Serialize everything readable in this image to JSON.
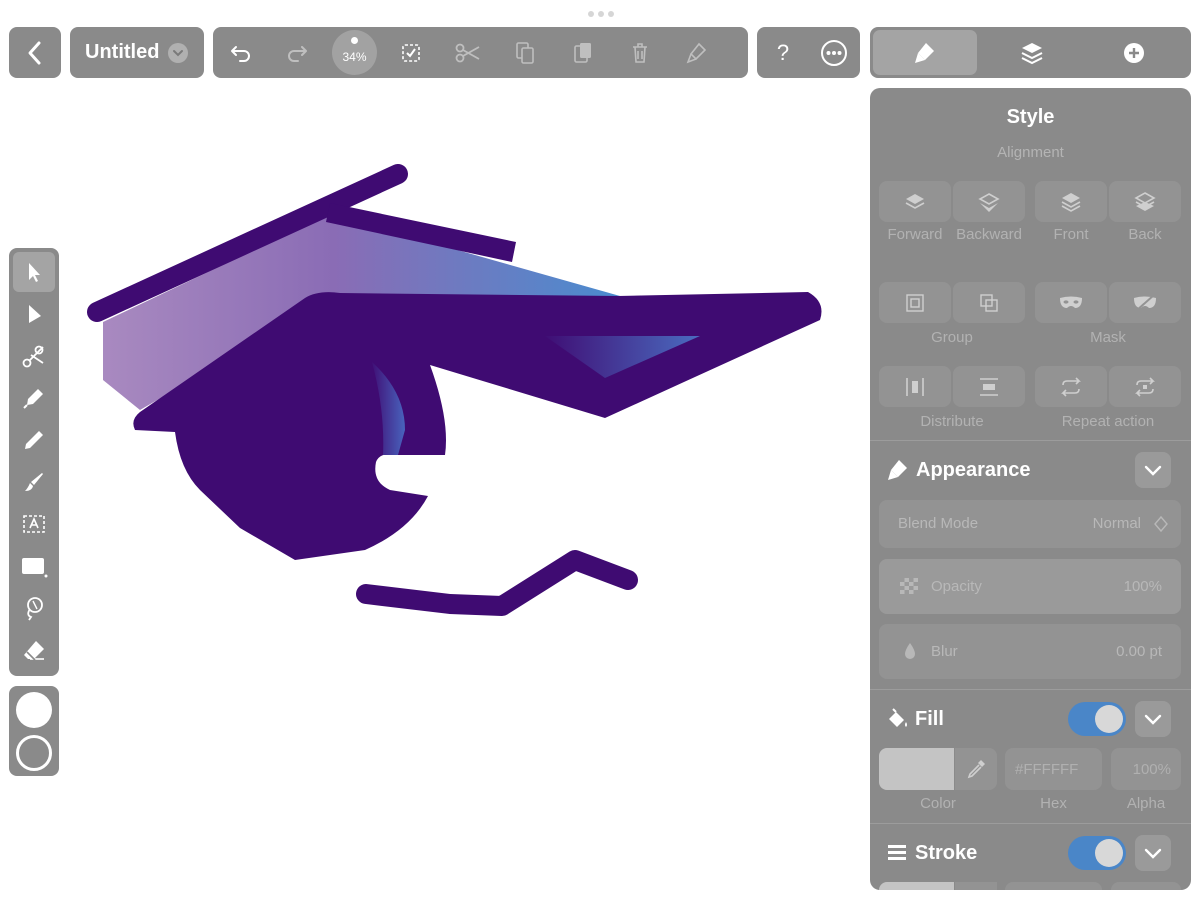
{
  "document": {
    "title": "Untitled"
  },
  "toolbar": {
    "zoom": "34%",
    "help": "?"
  },
  "panel": {
    "title": "Style",
    "alignment_label": "Alignment",
    "arrange": [
      {
        "label": "Forward",
        "icon": "bring-forward-icon"
      },
      {
        "label": "Backward",
        "icon": "send-backward-icon"
      },
      {
        "label": "Front",
        "icon": "bring-to-front-icon"
      },
      {
        "label": "Back",
        "icon": "send-to-back-icon"
      }
    ],
    "group_label": "Group",
    "mask_label": "Mask",
    "distribute_label": "Distribute",
    "repeat_label": "Repeat action",
    "appearance": {
      "title": "Appearance",
      "blend_mode_label": "Blend Mode",
      "blend_mode_value": "Normal",
      "opacity_label": "Opacity",
      "opacity_value": "100%",
      "blur_label": "Blur",
      "blur_value": "0.00 pt"
    },
    "fill": {
      "title": "Fill",
      "enabled": true,
      "color": "#C4C4C4",
      "hex_placeholder": "#FFFFFF",
      "alpha": "100%",
      "color_label": "Color",
      "hex_label": "Hex",
      "alpha_label": "Alpha"
    },
    "stroke": {
      "title": "Stroke",
      "enabled": true
    }
  },
  "colors": {
    "chrome": "#8a8a8a",
    "accent_toggle": "#4a86c8",
    "artwork_primary": "#3f0b72",
    "gradient_light": "#a98ac0",
    "gradient_blue": "#4a8ccf"
  }
}
